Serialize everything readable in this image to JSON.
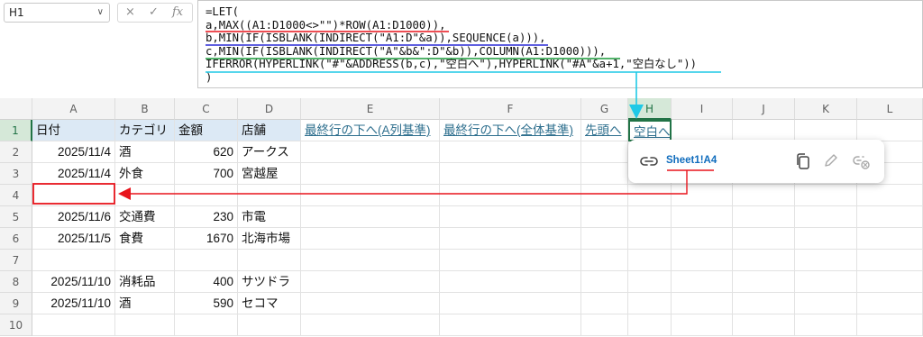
{
  "namebox": "H1",
  "fx_icons": {
    "cancel": "×",
    "enter": "✓",
    "fx": "fx"
  },
  "formula": [
    "=LET(",
    "a,MAX((A1:D1000<>\"\")*ROW(A1:D1000)),",
    "b,MIN(IF(ISBLANK(INDIRECT(\"A1:D\"&a)),SEQUENCE(a))),",
    "c,MIN(IF(ISBLANK(INDIRECT(\"A\"&b&\":D\"&b)),COLUMN(A1:D1000))),",
    "IFERROR(HYPERLINK(\"#\"&ADDRESS(b,c),\"空白へ\"),HYPERLINK(\"#A\"&a+1,\"空白なし\"))",
    ")"
  ],
  "columns": [
    "A",
    "B",
    "C",
    "D",
    "E",
    "F",
    "G",
    "H",
    "I",
    "J",
    "K",
    "L"
  ],
  "selected_column": "H",
  "row_numbers": [
    "1",
    "2",
    "3",
    "4",
    "5",
    "6",
    "7",
    "8",
    "9",
    "10"
  ],
  "header_row": {
    "A": "日付",
    "B": "カテゴリ",
    "C": "金額",
    "D": "店舗",
    "E": "最終行の下へ(A列基準)",
    "F": "最終行の下へ(全体基準)",
    "G": "先頭へ",
    "H": "空白へ"
  },
  "rows": [
    {
      "date": "2025/11/4",
      "category": "酒",
      "amount": "620",
      "store": "アークス"
    },
    {
      "date": "2025/11/4",
      "category": "外食",
      "amount": "700",
      "store": "宮越屋"
    },
    {
      "date": "",
      "category": "",
      "amount": "",
      "store": ""
    },
    {
      "date": "2025/11/6",
      "category": "交通費",
      "amount": "230",
      "store": "市電"
    },
    {
      "date": "2025/11/5",
      "category": "食費",
      "amount": "1670",
      "store": "北海市場"
    },
    {
      "date": "",
      "category": "",
      "amount": "",
      "store": ""
    },
    {
      "date": "2025/11/10",
      "category": "消耗品",
      "amount": "400",
      "store": "サツドラ"
    },
    {
      "date": "2025/11/10",
      "category": "酒",
      "amount": "590",
      "store": "セコマ"
    },
    {
      "date": "",
      "category": "",
      "amount": "",
      "store": ""
    }
  ],
  "hovercard": {
    "target": "Sheet1!A4",
    "icons": [
      "link-icon",
      "copy-icon",
      "edit-icon",
      "remove-link-icon"
    ]
  },
  "colors": {
    "annotation_red": "#e8141c",
    "annotation_blue": "#2b2bd6",
    "annotation_green": "#1a9a3a",
    "annotation_cyan": "#1fc9e6",
    "header_fill": "#dce9f5",
    "link_text": "#2e6f8e",
    "selection": "#217346"
  }
}
